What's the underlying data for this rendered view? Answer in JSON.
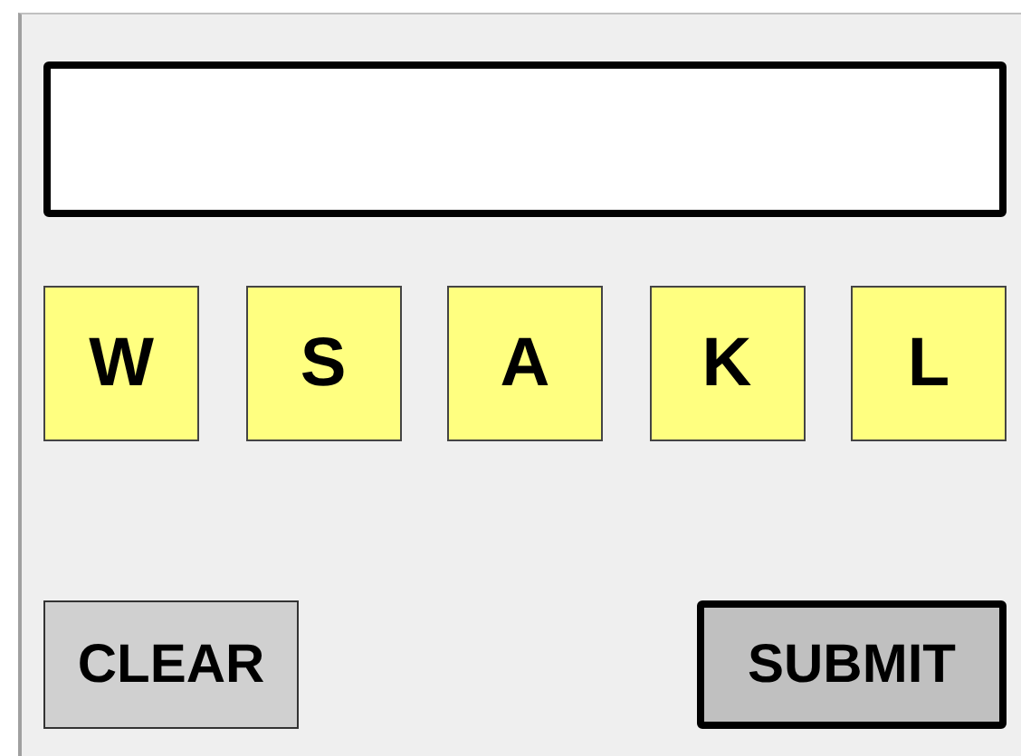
{
  "letters": [
    {
      "label": "W"
    },
    {
      "label": "S"
    },
    {
      "label": "A"
    },
    {
      "label": "K"
    },
    {
      "label": "L"
    }
  ],
  "buttons": [
    {
      "label": "CLEAR",
      "default": false
    },
    {
      "label": "SUBMIT",
      "default": true
    }
  ]
}
